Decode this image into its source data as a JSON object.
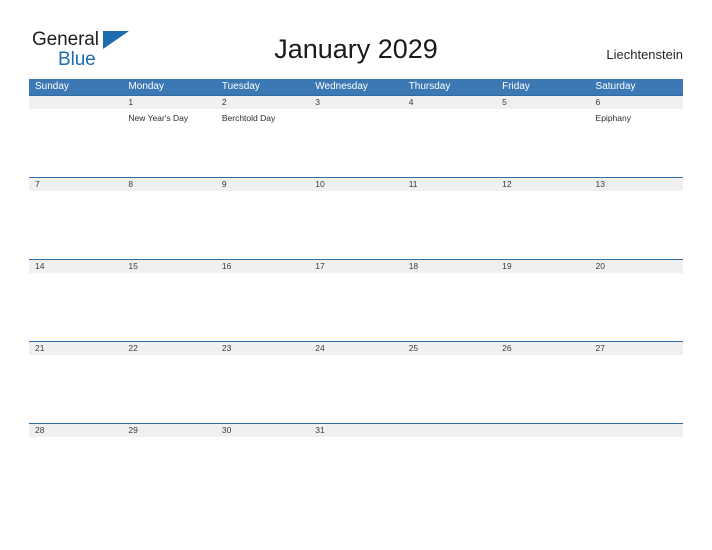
{
  "brand": {
    "name_part1": "General",
    "name_part2": "Blue",
    "flag_icon": "blue-triangle-flag"
  },
  "header": {
    "title": "January 2029",
    "country": "Liechtenstein"
  },
  "colors": {
    "header_blue": "#3c78b4",
    "row_separator_blue": "#2e6da4",
    "date_band_gray": "#f0f0f0",
    "brand_blue": "#1f6cb0",
    "text_dark": "#231f20"
  },
  "calendar": {
    "weekdays": [
      "Sunday",
      "Monday",
      "Tuesday",
      "Wednesday",
      "Thursday",
      "Friday",
      "Saturday"
    ],
    "weeks": [
      {
        "days": [
          {
            "date": "",
            "event": ""
          },
          {
            "date": "1",
            "event": "New Year's Day"
          },
          {
            "date": "2",
            "event": "Berchtold Day"
          },
          {
            "date": "3",
            "event": ""
          },
          {
            "date": "4",
            "event": ""
          },
          {
            "date": "5",
            "event": ""
          },
          {
            "date": "6",
            "event": "Epiphany"
          }
        ]
      },
      {
        "days": [
          {
            "date": "7",
            "event": ""
          },
          {
            "date": "8",
            "event": ""
          },
          {
            "date": "9",
            "event": ""
          },
          {
            "date": "10",
            "event": ""
          },
          {
            "date": "11",
            "event": ""
          },
          {
            "date": "12",
            "event": ""
          },
          {
            "date": "13",
            "event": ""
          }
        ]
      },
      {
        "days": [
          {
            "date": "14",
            "event": ""
          },
          {
            "date": "15",
            "event": ""
          },
          {
            "date": "16",
            "event": ""
          },
          {
            "date": "17",
            "event": ""
          },
          {
            "date": "18",
            "event": ""
          },
          {
            "date": "19",
            "event": ""
          },
          {
            "date": "20",
            "event": ""
          }
        ]
      },
      {
        "days": [
          {
            "date": "21",
            "event": ""
          },
          {
            "date": "22",
            "event": ""
          },
          {
            "date": "23",
            "event": ""
          },
          {
            "date": "24",
            "event": ""
          },
          {
            "date": "25",
            "event": ""
          },
          {
            "date": "26",
            "event": ""
          },
          {
            "date": "27",
            "event": ""
          }
        ]
      },
      {
        "days": [
          {
            "date": "28",
            "event": ""
          },
          {
            "date": "29",
            "event": ""
          },
          {
            "date": "30",
            "event": ""
          },
          {
            "date": "31",
            "event": ""
          },
          {
            "date": "",
            "event": ""
          },
          {
            "date": "",
            "event": ""
          },
          {
            "date": "",
            "event": ""
          }
        ]
      }
    ]
  }
}
